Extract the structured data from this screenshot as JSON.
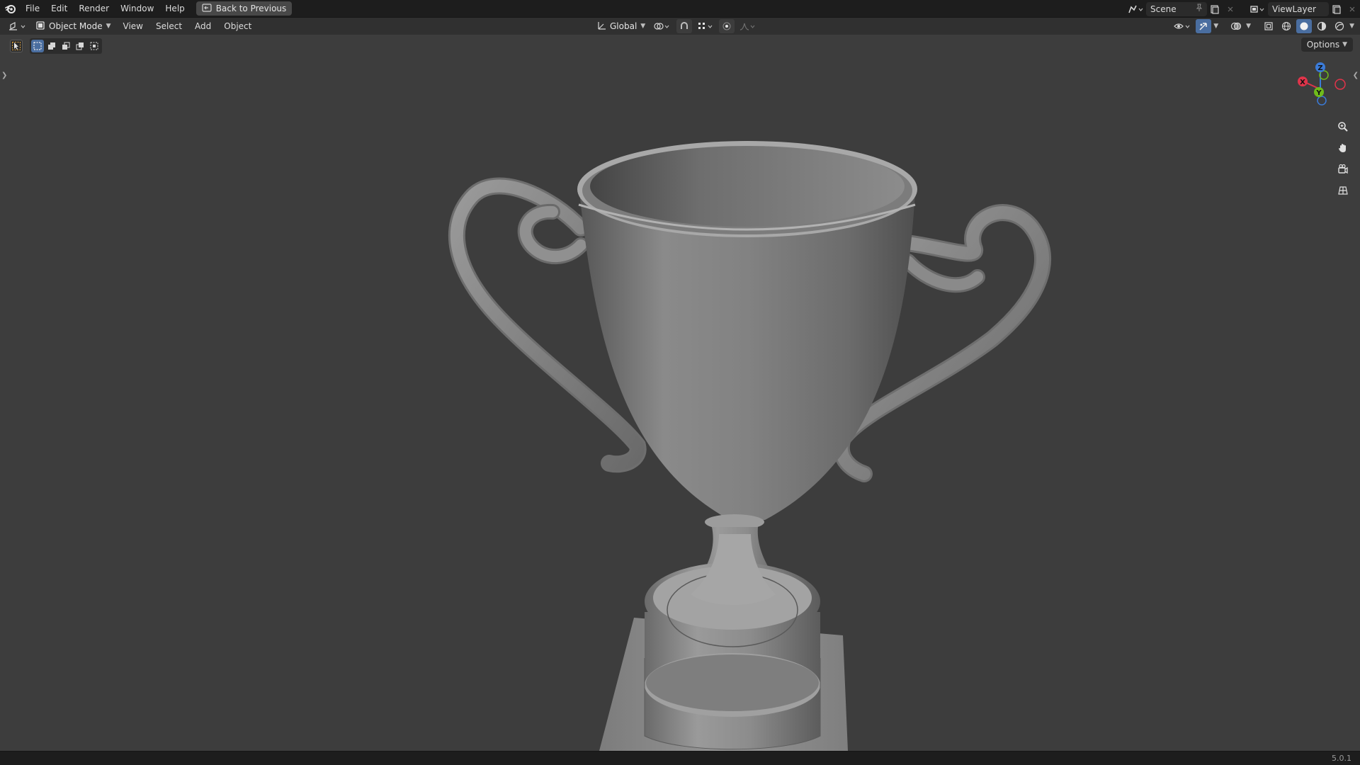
{
  "menu": {
    "file": "File",
    "edit": "Edit",
    "render": "Render",
    "window": "Window",
    "help": "Help",
    "back_label": "Back to Previous"
  },
  "top_right": {
    "scene": "Scene",
    "view_layer": "ViewLayer"
  },
  "header": {
    "mode": "Object Mode",
    "view": "View",
    "select": "Select",
    "add": "Add",
    "object": "Object",
    "orientation": "Global"
  },
  "viewport": {
    "options": "Options",
    "axis_x": "X",
    "axis_y": "Y",
    "axis_z": "Z"
  },
  "status": {
    "version": "5.0.1"
  },
  "colors": {
    "accent": "#4a6ea0",
    "axis_x": "#e0344a",
    "axis_y": "#6fbb1b",
    "axis_z": "#3b7bd8"
  }
}
